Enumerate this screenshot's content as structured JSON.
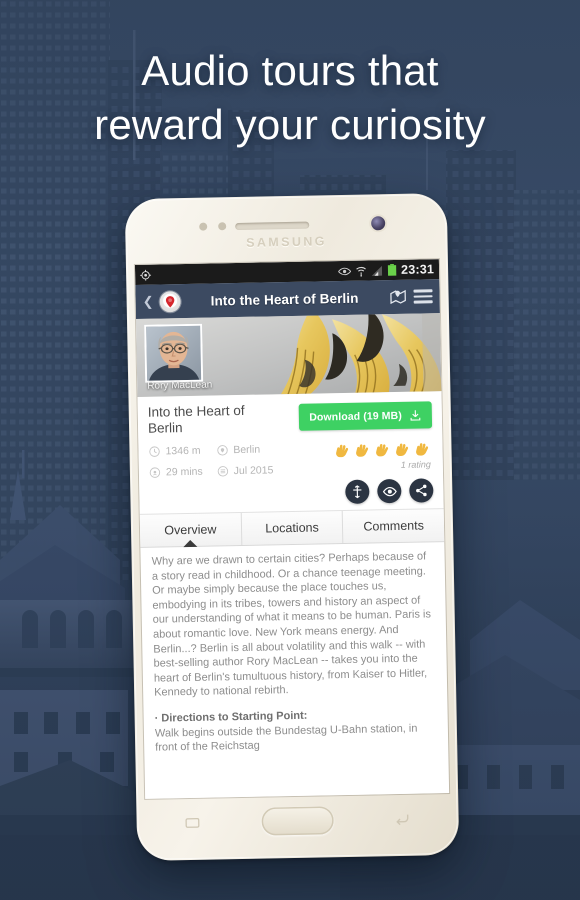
{
  "promo": {
    "headline_line1": "Audio tours that",
    "headline_line2": "reward your curiosity",
    "background_description": "city-skyline-blue-tinted"
  },
  "device": {
    "brand": "SAMSUNG",
    "nav": {
      "recent_icon": "recent-apps-icon",
      "home_icon": "home-button",
      "back_icon": "back-arrow-icon"
    }
  },
  "statusbar": {
    "left_icon": "gps-location-icon",
    "icons": [
      "eye-icon",
      "wifi-icon",
      "signal-icon",
      "battery-icon"
    ],
    "time": "23:31"
  },
  "appbar": {
    "back_icon": "back-chevron-icon",
    "logo_icon": "map-pin-logo-icon",
    "title": "Into the Heart of Berlin",
    "map_icon": "map-book-icon",
    "menu_icon": "hamburger-menu-icon"
  },
  "hero": {
    "image_description": "golden-german-eagle-emblem",
    "author_name": "Rory MacLean",
    "author_photo_description": "portrait-of-man-with-glasses"
  },
  "tour": {
    "title": "Into the Heart of Berlin",
    "download_label": "Download (19 MB)",
    "download_icon": "download-icon",
    "meta": [
      {
        "icon": "distance-icon",
        "value": "1346 m"
      },
      {
        "icon": "city-icon",
        "value": "Berlin"
      },
      {
        "icon": "duration-icon",
        "value": "29 mins"
      },
      {
        "icon": "calendar-icon",
        "value": "Jul 2015"
      }
    ],
    "rating": {
      "icon": "clap-icon",
      "value": 5,
      "max": 5,
      "count_label": "1 rating"
    },
    "actions": [
      {
        "icon": "route-directions-icon",
        "label": "Directions"
      },
      {
        "icon": "eye-preview-icon",
        "label": "Preview"
      },
      {
        "icon": "share-icon",
        "label": "Share"
      }
    ]
  },
  "tabs": [
    {
      "label": "Overview",
      "active": true
    },
    {
      "label": "Locations",
      "active": false
    },
    {
      "label": "Comments",
      "active": false
    }
  ],
  "description": {
    "paragraph": "Why are we drawn to certain cities? Perhaps because of a story read in childhood. Or a chance teenage meeting. Or maybe simply because the place touches us, embodying in its tribes, towers and history an aspect of our understanding of what it means to be human. Paris is about romantic love. New York means energy. And Berlin...? Berlin is all about volatility and this walk -- with best-selling author Rory MacLean -- takes you into the heart of Berlin's tumultuous history, from Kaiser to Hitler, Kennedy to national rebirth.",
    "directions_heading": "· Directions to Starting Point:",
    "directions_body": "Walk begins outside the Bundestag U-Bahn station, in front of the Reichstag"
  },
  "colors": {
    "accent_green": "#3ed163",
    "appbar_blue": "#3c4a61",
    "rating_gold": "#f0b840",
    "background_blue": "#33455e"
  }
}
